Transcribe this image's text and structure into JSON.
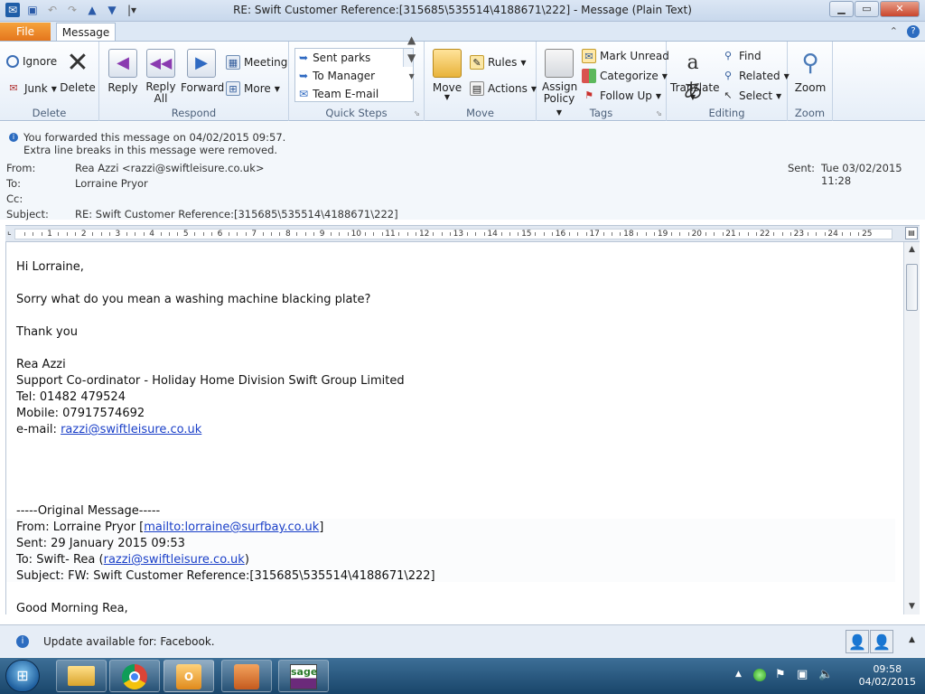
{
  "window": {
    "title": "RE: Swift Customer Reference:[315685\\535514\\4188671\\222]  -  Message (Plain Text)"
  },
  "tabs": {
    "file": "File",
    "message": "Message"
  },
  "ribbon": {
    "delete_group": {
      "ignore": "Ignore",
      "junk": "Junk",
      "delete": "Delete",
      "label": "Delete"
    },
    "respond_group": {
      "reply": "Reply",
      "reply_all_1": "Reply",
      "reply_all_2": "All",
      "forward": "Forward",
      "meeting": "Meeting",
      "more": "More",
      "label": "Respond"
    },
    "quick_steps": {
      "items": [
        "Sent parks",
        "To Manager",
        "Team E-mail"
      ],
      "label": "Quick Steps"
    },
    "move_group": {
      "move": "Move",
      "rules": "Rules",
      "actions": "Actions",
      "label": "Move"
    },
    "tags_group": {
      "assign_1": "Assign",
      "assign_2": "Policy",
      "mark_unread": "Mark Unread",
      "categorize": "Categorize",
      "follow_up": "Follow Up",
      "label": "Tags"
    },
    "editing_group": {
      "translate": "Translate",
      "find": "Find",
      "related": "Related",
      "select": "Select",
      "label": "Editing"
    },
    "zoom_group": {
      "zoom": "Zoom",
      "label": "Zoom"
    }
  },
  "info": {
    "line1": "You forwarded this message on 04/02/2015 09:57.",
    "line2": "Extra line breaks in this message were removed."
  },
  "header": {
    "from_label": "From:",
    "from_value": "Rea Azzi <razzi@swiftleisure.co.uk>",
    "to_label": "To:",
    "to_value": "Lorraine Pryor",
    "cc_label": "Cc:",
    "subject_label": "Subject:",
    "subject_value": "RE: Swift Customer Reference:[315685\\535514\\4188671\\222]",
    "sent_label": "Sent:",
    "sent_value": "Tue 03/02/2015 11:28"
  },
  "ruler": {
    "numbers": [
      "1",
      "2",
      "3",
      "4",
      "5",
      "6",
      "7",
      "8",
      "9",
      "10",
      "11",
      "12",
      "13",
      "14",
      "15",
      "16",
      "17",
      "18",
      "19",
      "20",
      "21",
      "22",
      "23",
      "24",
      "25"
    ]
  },
  "body": {
    "greeting": "Hi Lorraine,",
    "question": "Sorry what do you mean a washing machine blacking plate?",
    "thanks": "Thank you",
    "sig_name": "Rea Azzi",
    "sig_title": "Support Co-ordinator - Holiday Home Division Swift Group Limited",
    "sig_tel": "Tel: 01482 479524",
    "sig_mobile": "Mobile: 07917574692",
    "sig_email_label": "e-mail: ",
    "sig_email": "razzi@swiftleisure.co.uk",
    "orig_sep": "-----Original Message-----",
    "orig_from_a": "From: Lorraine Pryor [",
    "orig_from_link": "mailto:lorraine@surfbay.co.uk",
    "orig_from_b": "]",
    "orig_sent": "Sent: 29 January 2015 09:53",
    "orig_to_a": "To: Swift- Rea (",
    "orig_to_link": "razzi@swiftleisure.co.uk",
    "orig_to_b": ")",
    "orig_subject": "Subject: FW: Swift Customer Reference:[315685\\535514\\4188671\\222]",
    "orig_greeting": "Good Morning Rea,"
  },
  "status": {
    "update": "Update available for: Facebook."
  },
  "taskbar": {
    "time": "09:58",
    "date": "04/02/2015",
    "sage": "sage"
  }
}
